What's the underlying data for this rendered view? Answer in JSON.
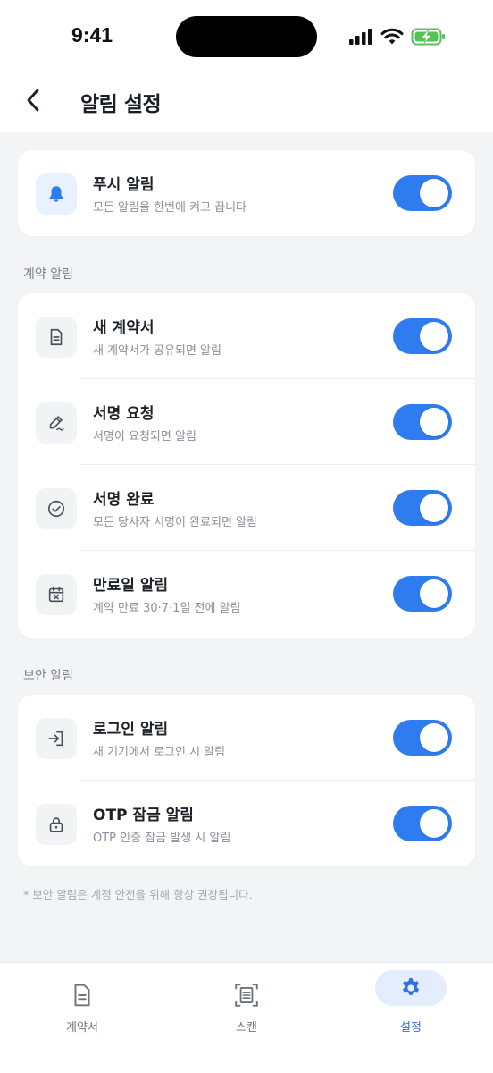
{
  "status_bar": {
    "time": "9:41"
  },
  "header": {
    "title": "알림 설정"
  },
  "push": {
    "label": "푸시 알림",
    "desc": "모든 알림을 한번에 켜고 끕니다",
    "enabled": true,
    "icon": "bell-icon"
  },
  "contract_section": {
    "title": "계약 알림",
    "items": [
      {
        "label": "새 계약서",
        "desc": "새 계약서가 공유되면 알림",
        "enabled": true,
        "icon": "document-icon"
      },
      {
        "label": "서명 요청",
        "desc": "서명이 요청되면 알림",
        "enabled": true,
        "icon": "signature-icon"
      },
      {
        "label": "서명 완료",
        "desc": "모든 당사자 서명이 완료되면 알림",
        "enabled": true,
        "icon": "check-circle-icon"
      },
      {
        "label": "만료일 알림",
        "desc": "계약 만료 30·7·1일 전에 알림",
        "enabled": true,
        "icon": "calendar-x-icon"
      }
    ]
  },
  "security_section": {
    "title": "보안 알림",
    "items": [
      {
        "label": "로그인 알림",
        "desc": "새 기기에서 로그인 시 알림",
        "enabled": true,
        "icon": "login-icon"
      },
      {
        "label": "OTP 잠금 알림",
        "desc": "OTP 인증 잠금 발생 시 알림",
        "enabled": true,
        "icon": "lock-icon"
      }
    ]
  },
  "footnote": "* 보안 알림은 계정 안전을 위해 항상 권장됩니다.",
  "tabs": [
    {
      "label": "계약서",
      "icon": "document-icon",
      "active": false
    },
    {
      "label": "스캔",
      "icon": "scan-icon",
      "active": false
    },
    {
      "label": "설정",
      "icon": "gear-icon",
      "active": true
    }
  ],
  "colors": {
    "accent": "#2f7cf0",
    "background": "#f3f4f6",
    "card": "#ffffff"
  }
}
